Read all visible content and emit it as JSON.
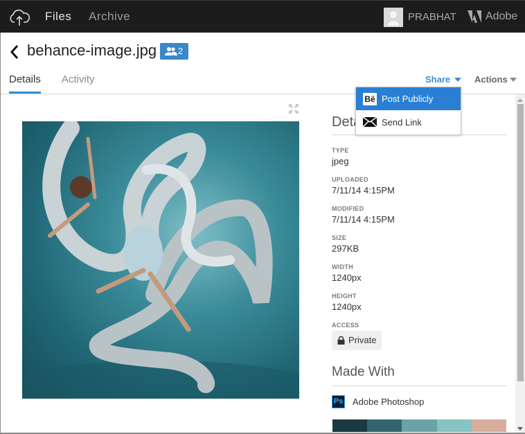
{
  "topbar": {
    "nav": [
      {
        "label": "Files",
        "active": true
      },
      {
        "label": "Archive",
        "active": false
      }
    ],
    "user": {
      "name": "PRABHAT"
    },
    "brand": {
      "label": "Adobe"
    }
  },
  "file": {
    "name": "behance-image.jpg",
    "collaborators_count": "2"
  },
  "tabs": [
    {
      "label": "Details",
      "active": true
    },
    {
      "label": "Activity",
      "active": false
    }
  ],
  "toolbar": {
    "share_label": "Share",
    "actions_label": "Actions"
  },
  "share_menu": {
    "items": [
      {
        "icon": "behance-icon",
        "icon_text": "Bē",
        "label": "Post Publicly",
        "highlighted": true
      },
      {
        "icon": "mail-icon",
        "label": "Send Link",
        "highlighted": false
      }
    ]
  },
  "details": {
    "title": "Details",
    "fields": [
      {
        "label": "TYPE",
        "value": "jpeg"
      },
      {
        "label": "UPLOADED",
        "value": "7/11/14 4:15PM"
      },
      {
        "label": "MODIFIED",
        "value": "7/11/14 4:15PM"
      },
      {
        "label": "SIZE",
        "value": "297KB"
      },
      {
        "label": "WIDTH",
        "value": "1240px"
      },
      {
        "label": "HEIGHT",
        "value": "1240px"
      }
    ],
    "access": {
      "label": "ACCESS",
      "value": "Private"
    }
  },
  "made_with": {
    "title": "Made With",
    "app_icon_text": "Ps",
    "app_name": "Adobe Photoshop",
    "palette": [
      "#1b3943",
      "#33656f",
      "#6ba2a6",
      "#86c3c2",
      "#d8ac9c"
    ]
  },
  "colors": {
    "accent": "#2a7fd4",
    "topbar": "#1c1c1c"
  }
}
